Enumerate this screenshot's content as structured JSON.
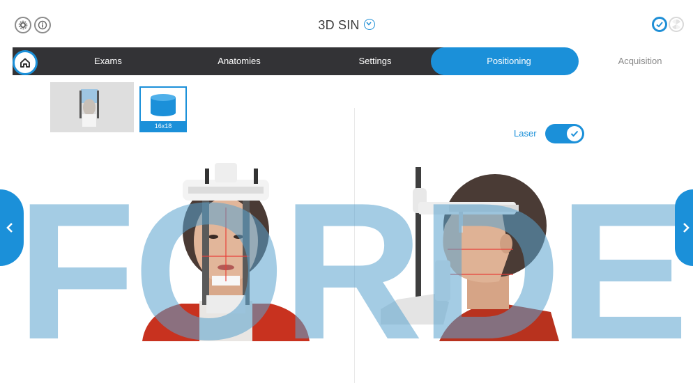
{
  "header": {
    "title": "3D SIN"
  },
  "nav": {
    "tabs": [
      {
        "label": "Exams"
      },
      {
        "label": "Anatomies"
      },
      {
        "label": "Settings"
      },
      {
        "label": "Positioning",
        "active": true
      },
      {
        "label": "Acquisition"
      }
    ]
  },
  "thumbnails": {
    "fov_label": "16x18"
  },
  "laser": {
    "label": "Laser",
    "enabled": true
  },
  "watermark": {
    "text": "FORDE"
  },
  "colors": {
    "accent": "#1b90d9",
    "nav_dark": "#333336",
    "watermark": "#5aa3cf"
  },
  "icons": [
    "settings-icon",
    "info-icon",
    "chevron-down-icon",
    "check-circle-icon",
    "radiation-icon",
    "home-icon",
    "chevron-left-icon",
    "chevron-right-icon",
    "check-icon"
  ]
}
